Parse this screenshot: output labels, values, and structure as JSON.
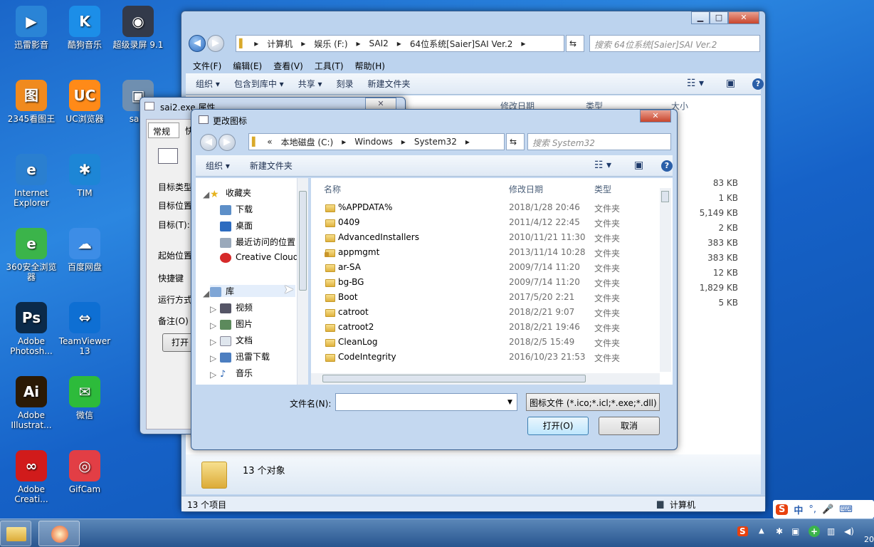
{
  "desktop": {
    "icons": [
      {
        "label": "迅雷影音",
        "color": "#2a84d6",
        "glyph": "▶"
      },
      {
        "label": "酷狗音乐",
        "color": "#1c8ee8",
        "glyph": "K"
      },
      {
        "label": "超级录屏 9.1",
        "color": "#333a4a",
        "glyph": "◉"
      },
      {
        "label": "2345看图王",
        "color": "#f08a1e",
        "glyph": "图"
      },
      {
        "label": "UC浏览器",
        "color": "#ff8a18",
        "glyph": "UC"
      },
      {
        "label": "sai2",
        "color": "#6f8fb0",
        "glyph": "▣"
      },
      {
        "label": "Internet Explorer",
        "color": "#2a7fd0",
        "glyph": "e"
      },
      {
        "label": "TIM",
        "color": "#1d86d6",
        "glyph": "✱"
      },
      {
        "label": "360安全浏览器",
        "color": "#3bb44a",
        "glyph": "e"
      },
      {
        "label": "百度网盘",
        "color": "#3d8de6",
        "glyph": "☁"
      },
      {
        "label": "Adobe Photosh...",
        "color": "#0b2a4a",
        "glyph": "Ps"
      },
      {
        "label": "TeamViewer 13",
        "color": "#0e6fd3",
        "glyph": "⇔"
      },
      {
        "label": "Adobe Illustrat...",
        "color": "#2b1a05",
        "glyph": "Ai"
      },
      {
        "label": "微信",
        "color": "#2dbb3b",
        "glyph": "✉"
      },
      {
        "label": "Adobe Creati...",
        "color": "#d11b1b",
        "glyph": "∞"
      },
      {
        "label": "GifCam",
        "color": "#e23e45",
        "glyph": "◎"
      }
    ]
  },
  "explorer": {
    "breadcrumb": [
      "计算机",
      "娱乐 (F:)",
      "SAI2",
      "64位系统[Saier]SAI Ver.2"
    ],
    "search_placeholder": "搜索 64位系统[Saier]SAI Ver.2",
    "menu": [
      "文件(F)",
      "编辑(E)",
      "查看(V)",
      "工具(T)",
      "帮助(H)"
    ],
    "toolbar": [
      "组织 ▾",
      "包含到库中 ▾",
      "共享 ▾",
      "刻录",
      "新建文件夹"
    ],
    "col_date": "修改日期",
    "col_type": "类型",
    "col_size": "大小",
    "sizes": [
      "83 KB",
      "1 KB",
      "5,149 KB",
      "2 KB",
      "383 KB",
      "383 KB",
      "12 KB",
      "1,829 KB",
      "5 KB"
    ],
    "details_count": "13 个对象",
    "status_items": "13 个项目",
    "status_location": "计算机"
  },
  "properties": {
    "title": "sai2.exe 属性",
    "tabs": [
      "常规",
      "快"
    ],
    "labels": [
      "目标类型",
      "目标位置",
      "目标(T):",
      "起始位置",
      "快捷键",
      "运行方式",
      "备注(O)"
    ],
    "open_button": "打开"
  },
  "dialog": {
    "title": "更改图标",
    "breadcrumb_prefix": "«",
    "breadcrumb": [
      "本地磁盘 (C:)",
      "Windows",
      "System32"
    ],
    "search_placeholder": "搜索 System32",
    "toolbar_organize": "组织 ▾",
    "toolbar_new_folder": "新建文件夹",
    "col_name": "名称",
    "col_date": "修改日期",
    "col_type": "类型",
    "tree": {
      "favorites": "收藏夹",
      "fav_items": [
        "下载",
        "桌面",
        "最近访问的位置",
        "Creative Cloud"
      ],
      "libraries": "库",
      "lib_items": [
        "视频",
        "图片",
        "文档",
        "迅雷下载",
        "音乐"
      ]
    },
    "files": [
      {
        "name": "%APPDATA%",
        "date": "2018/1/28 20:46",
        "type": "文件夹",
        "locked": false
      },
      {
        "name": "0409",
        "date": "2011/4/12 22:45",
        "type": "文件夹",
        "locked": false
      },
      {
        "name": "AdvancedInstallers",
        "date": "2010/11/21 11:30",
        "type": "文件夹",
        "locked": false
      },
      {
        "name": "appmgmt",
        "date": "2013/11/14 10:28",
        "type": "文件夹",
        "locked": true
      },
      {
        "name": "ar-SA",
        "date": "2009/7/14 11:20",
        "type": "文件夹",
        "locked": false
      },
      {
        "name": "bg-BG",
        "date": "2009/7/14 11:20",
        "type": "文件夹",
        "locked": false
      },
      {
        "name": "Boot",
        "date": "2017/5/20 2:21",
        "type": "文件夹",
        "locked": false
      },
      {
        "name": "catroot",
        "date": "2018/2/21 9:07",
        "type": "文件夹",
        "locked": false
      },
      {
        "name": "catroot2",
        "date": "2018/2/21 19:46",
        "type": "文件夹",
        "locked": false
      },
      {
        "name": "CleanLog",
        "date": "2018/2/5 15:49",
        "type": "文件夹",
        "locked": false
      },
      {
        "name": "CodeIntegrity",
        "date": "2016/10/23 21:53",
        "type": "文件夹",
        "locked": false
      }
    ],
    "filename_label": "文件名(N):",
    "filename_value": "",
    "filter": "图标文件 (*.ico;*.icl;*.exe;*.dll)",
    "open_button": "打开(O)",
    "cancel_button": "取消"
  },
  "tray": {
    "ime": [
      "中",
      "°,",
      "🎤",
      "⌨"
    ],
    "clock": "20"
  }
}
